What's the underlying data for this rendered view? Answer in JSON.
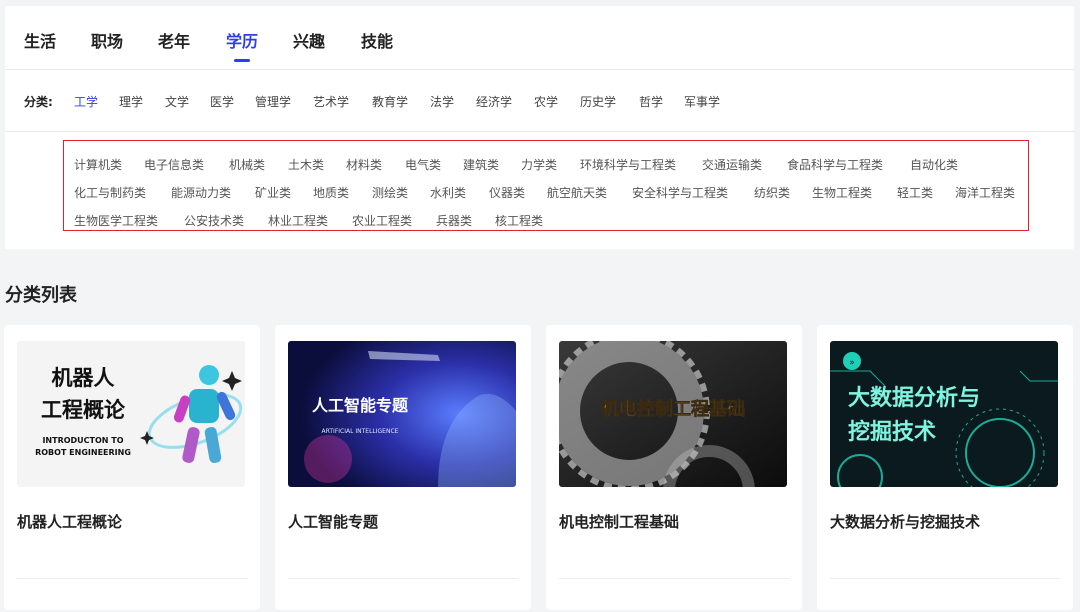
{
  "tabs": [
    "生活",
    "职场",
    "老年",
    "学历",
    "兴趣",
    "技能"
  ],
  "category_label": "分类:",
  "categories": [
    "工学",
    "理学",
    "文学",
    "医学",
    "管理学",
    "艺术学",
    "教育学",
    "法学",
    "经济学",
    "农学",
    "历史学",
    "哲学",
    "军事学"
  ],
  "subcategories": [
    "计算机类",
    "电子信息类",
    "机械类",
    "土木类",
    "材料类",
    "电气类",
    "建筑类",
    "力学类",
    "环境科学与工程类",
    "交通运输类",
    "食品科学与工程类",
    "自动化类",
    "化工与制药类",
    "能源动力类",
    "矿业类",
    "地质类",
    "测绘类",
    "水利类",
    "仪器类",
    "航空航天类",
    "安全科学与工程类",
    "纺织类",
    "生物工程类",
    "轻工类",
    "海洋工程类",
    "生物医学工程类",
    "公安技术类",
    "林业工程类",
    "农业工程类",
    "兵器类",
    "核工程类"
  ],
  "section_title": "分类列表",
  "courses": [
    {
      "title": "机器人工程概论",
      "thumb_lines": [
        "机器人",
        "工程概论"
      ],
      "thumb_en": [
        "INTRODUCTON TO",
        "ROBOT ENGINEERING"
      ]
    },
    {
      "title": "人工智能专题",
      "thumb_lines": [
        "人工智能专题"
      ],
      "thumb_en": [
        "ARTIFICIAL INTELLIGENCE"
      ]
    },
    {
      "title": "机电控制工程基础",
      "thumb_lines": [
        "机电控制工程基础"
      ],
      "thumb_en": []
    },
    {
      "title": "大数据分析与挖掘技术",
      "thumb_lines": [
        "大数据分析与",
        "挖掘技术"
      ],
      "thumb_en": []
    }
  ],
  "colors": {
    "accent": "#2f3df0",
    "highlight_border": "#e0242f"
  }
}
